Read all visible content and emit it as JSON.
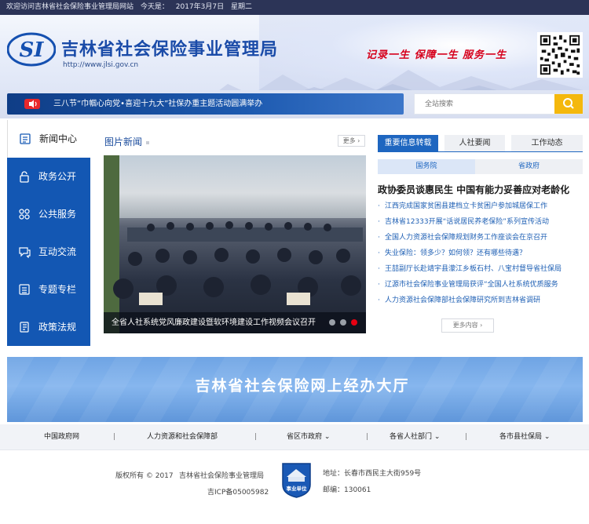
{
  "topbar": {
    "welcome": "欢迎访问吉林省社会保险事业管理局网站",
    "today_label": "今天是：",
    "date": "2017年3月7日",
    "weekday": "星期二"
  },
  "header": {
    "logo_text": "SI",
    "title": "吉林省社会保险事业管理局",
    "url": "http://www.jlsi.gov.cn",
    "slogan": "记录一生  保障一生  服务一生",
    "qr_icon": "qr-code-icon"
  },
  "notice": {
    "icon": "speaker-icon",
    "text": "三八节“巾帼心向党•喜迎十九大”社保办重主题活动圆满举办"
  },
  "search": {
    "placeholder": "全站搜索",
    "button_icon": "search-icon"
  },
  "nav": [
    {
      "label": "新闻中心",
      "icon": "news-icon",
      "active": true
    },
    {
      "label": "政务公开",
      "icon": "lock-icon",
      "active": false
    },
    {
      "label": "公共服务",
      "icon": "grid-icon",
      "active": false
    },
    {
      "label": "互动交流",
      "icon": "chat-icon",
      "active": false
    },
    {
      "label": "专题专栏",
      "icon": "list-icon",
      "active": false
    },
    {
      "label": "政策法规",
      "icon": "book-icon",
      "active": false
    }
  ],
  "photo_news": {
    "title": "图片新闻",
    "more": "更多",
    "caption": "全省人社系统党风廉政建设暨软环境建设工作视频会议召开",
    "slides": 3,
    "active_slide": 3
  },
  "tabs": [
    {
      "label": "重要信息转载",
      "active": true
    },
    {
      "label": "人社要闻",
      "active": false
    },
    {
      "label": "工作动态",
      "active": false
    }
  ],
  "subtabs": [
    {
      "label": "国务院",
      "active": true
    },
    {
      "label": "省政府",
      "active": false
    }
  ],
  "headline": "政协委员谈惠民生 中国有能力妥善应对老龄化",
  "news": [
    "江西完成国家贫困县建档立卡贫困户参加城居保工作",
    "吉林省12333开展“话说居民养老保险”系列宣传活动",
    "全国人力资源社会保障规划财务工作座谈会在京召开",
    "失业保险：领多少？如何领？还有哪些待遇？",
    "王喆副厅长赴靖宇县濛江乡板石村、八宝村督导省社保局",
    "辽源市社会保险事业管理局获评“全国人社系统优质服务",
    "人力资源社会保障部社会保障研究所到吉林省调研"
  ],
  "news_more": "更多内容",
  "banner": {
    "title": "吉林省社会保险网上经办大厅"
  },
  "links": [
    {
      "label": "中国政府网"
    },
    {
      "label": "人力资源和社会保障部"
    },
    {
      "label": "省区市政府"
    },
    {
      "label": "各省人社部门"
    },
    {
      "label": "各市县社保局"
    }
  ],
  "link_separator": "|",
  "footer": {
    "copyright": "版权所有 © 2017",
    "org": "吉林省社会保险事业管理局",
    "icp": "吉ICP备05005982",
    "badge_text": "事业单位",
    "address": "地址：长春市西民主大街959号",
    "postcode": "邮编：130061"
  },
  "colors": {
    "primary_blue": "#1357b3",
    "dark_top": "#2c3457",
    "accent_yellow": "#f4b80d",
    "slogan_red": "#d6001c"
  }
}
